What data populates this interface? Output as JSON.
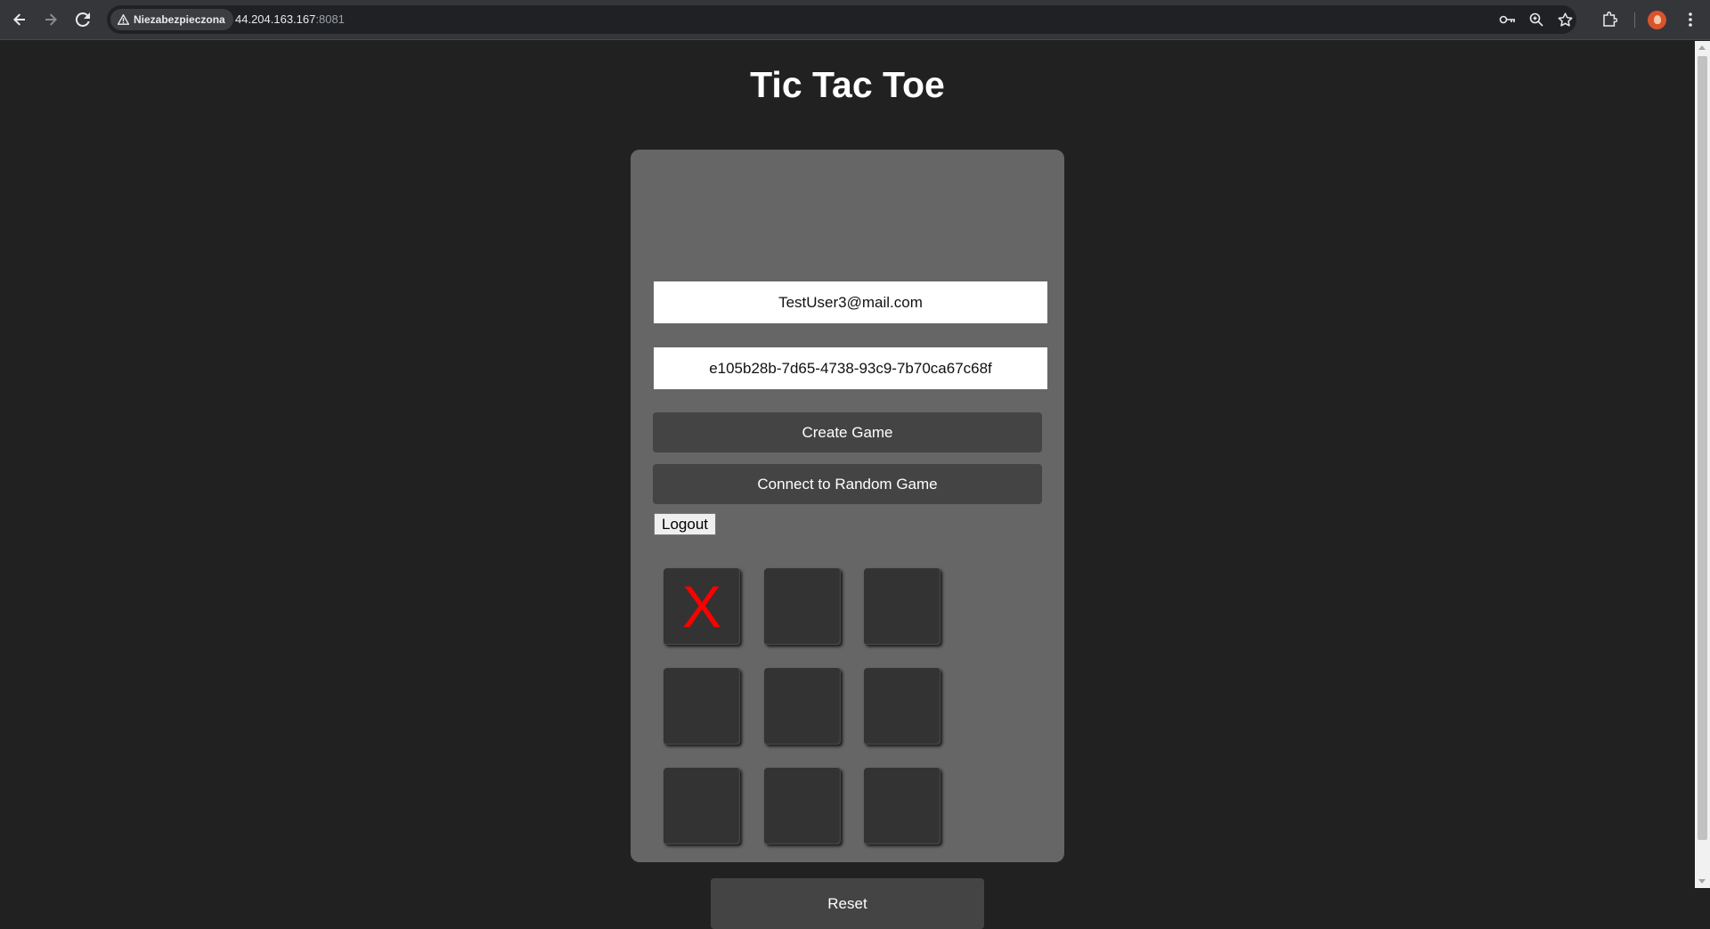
{
  "browser": {
    "security_label": "Niezabezpieczona",
    "url_host": "44.204.163.167",
    "url_port": ":8081"
  },
  "page": {
    "title": "Tic Tac Toe",
    "email_value": "TestUser3@mail.com",
    "game_id_value": "e105b28b-7d65-4738-93c9-7b70ca67c68f",
    "create_game_label": "Create Game",
    "connect_random_label": "Connect to Random Game",
    "logout_label": "Logout",
    "reset_label": "Reset",
    "mark_color": "#ff0000",
    "board": [
      "X",
      "",
      "",
      "",
      "",
      "",
      "",
      "",
      ""
    ]
  }
}
